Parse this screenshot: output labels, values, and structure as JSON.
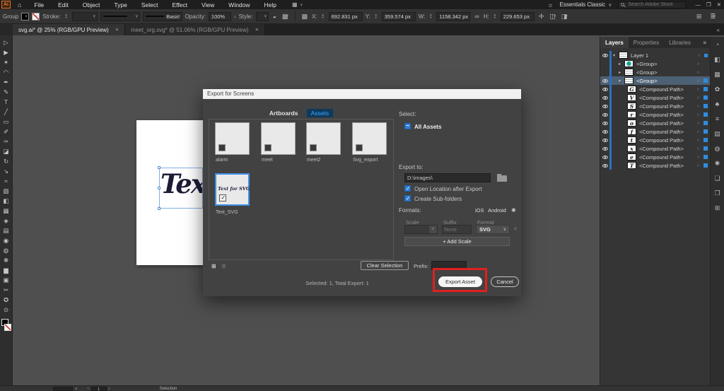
{
  "app": {
    "menus": [
      "File",
      "Edit",
      "Object",
      "Type",
      "Select",
      "Effect",
      "View",
      "Window",
      "Help"
    ],
    "workspace": "Essentials Classic",
    "search_placeholder": "Search Adobe Stock"
  },
  "control_bar": {
    "context_label": "Group",
    "stroke_label": "Stroke:",
    "brush_value": "Basic",
    "opacity_label": "Opacity:",
    "opacity_value": "100%",
    "style_label": "Style:",
    "x_label": "X:",
    "x_value": "692.831 px",
    "y_label": "Y:",
    "y_value": "359.574 px",
    "w_label": "W:",
    "w_value": "1158.342 px",
    "h_label": "H:",
    "h_value": "229.653 px"
  },
  "document_tabs": [
    {
      "label": "svg.ai* @ 25% (RGB/GPU Preview)"
    },
    {
      "label": "meet_org.svg* @ 51.06% (RGB/GPU Preview)"
    }
  ],
  "canvas": {
    "artboard_text": "Tex"
  },
  "dialog": {
    "title": "Export for Screens",
    "tab_artboards": "Artboards",
    "tab_assets": "Assets",
    "assets": [
      {
        "name": "alarm"
      },
      {
        "name": "meet"
      },
      {
        "name": "meet2"
      },
      {
        "name": "Svg_export"
      },
      {
        "name": "Text_SVG",
        "thumb_text": "Text for SVG"
      }
    ],
    "select_label": "Select:",
    "all_assets_label": "All Assets",
    "export_to_label": "Export to:",
    "export_path": "D:\\images\\",
    "open_location_label": "Open Location after Export",
    "create_subfolders_label": "Create Sub-folders",
    "formats_label": "Formats:",
    "ios_label": "iOS",
    "android_label": "Android",
    "scale_header": "Scale",
    "suffix_header": "Suffix",
    "format_header": "Format",
    "suffix_placeholder": "None",
    "format_value": "SVG",
    "add_scale_label": "+ Add Scale",
    "clear_selection_label": "Clear Selection",
    "prefix_label": "Prefix:",
    "summary": "Selected: 1, Total Export: 1",
    "export_button": "Export Asset",
    "cancel_button": "Cancel"
  },
  "layers_panel": {
    "tabs": [
      "Layers",
      "Properties",
      "Libraries"
    ],
    "rows": [
      {
        "name": "Layer 1"
      },
      {
        "name": "<Group>"
      },
      {
        "name": "<Group>"
      },
      {
        "name": "<Group>"
      },
      {
        "name": "<Compound Path>",
        "letter": "G"
      },
      {
        "name": "<Compound Path>",
        "letter": "V"
      },
      {
        "name": "<Compound Path>",
        "letter": "S"
      },
      {
        "name": "<Compound Path>",
        "letter": "r"
      },
      {
        "name": "<Compound Path>",
        "letter": "o"
      },
      {
        "name": "<Compound Path>",
        "letter": "f"
      },
      {
        "name": "<Compound Path>",
        "letter": "t"
      },
      {
        "name": "<Compound Path>",
        "letter": "x"
      },
      {
        "name": "<Compound Path>",
        "letter": "e"
      },
      {
        "name": "<Compound Path>",
        "letter": "T"
      }
    ]
  },
  "status_bar": {
    "artboard_number": "1",
    "tool_name": "Selection"
  },
  "tools": [
    {
      "name": "selection-tool",
      "glyph": "▷"
    },
    {
      "name": "direct-selection-tool",
      "glyph": "▶"
    },
    {
      "name": "magic-wand-tool",
      "glyph": "✶"
    },
    {
      "name": "lasso-tool",
      "glyph": "◠"
    },
    {
      "name": "pen-tool",
      "glyph": "✒"
    },
    {
      "name": "curvature-tool",
      "glyph": "✎"
    },
    {
      "name": "type-tool",
      "glyph": "T"
    },
    {
      "name": "line-segment-tool",
      "glyph": "╱"
    },
    {
      "name": "rectangle-tool",
      "glyph": "▭"
    },
    {
      "name": "paintbrush-tool",
      "glyph": "✐"
    },
    {
      "name": "shaper-tool",
      "glyph": "✑"
    },
    {
      "name": "eraser-tool",
      "glyph": "◪"
    },
    {
      "name": "rotate-tool",
      "glyph": "↻"
    },
    {
      "name": "scale-tool",
      "glyph": "↘"
    },
    {
      "name": "width-tool",
      "glyph": "≈"
    },
    {
      "name": "free-transform-tool",
      "glyph": "▧"
    },
    {
      "name": "shape-builder-tool",
      "glyph": "◧"
    },
    {
      "name": "perspective-grid-tool",
      "glyph": "▦"
    },
    {
      "name": "mesh-tool",
      "glyph": "◈"
    },
    {
      "name": "gradient-tool",
      "glyph": "▤"
    },
    {
      "name": "eyedropper-tool",
      "glyph": "◉"
    },
    {
      "name": "blend-tool",
      "glyph": "◍"
    },
    {
      "name": "symbol-sprayer-tool",
      "glyph": "❋"
    },
    {
      "name": "column-graph-tool",
      "glyph": "▆"
    },
    {
      "name": "artboard-tool",
      "glyph": "▣"
    },
    {
      "name": "slice-tool",
      "glyph": "✂"
    },
    {
      "name": "hand-tool",
      "glyph": "✪"
    },
    {
      "name": "zoom-tool",
      "glyph": "⊙"
    }
  ],
  "panel_icons": [
    {
      "name": "color-panel-icon",
      "glyph": "◔"
    },
    {
      "name": "color-guide-panel-icon",
      "glyph": "◧"
    },
    {
      "name": "swatches-panel-icon",
      "glyph": "▦"
    },
    {
      "name": "brushes-panel-icon",
      "glyph": "✿"
    },
    {
      "name": "symbols-panel-icon",
      "glyph": "♣"
    },
    {
      "name": "stroke-panel-icon",
      "glyph": "≡"
    },
    {
      "name": "gradient-panel-icon",
      "glyph": "▤"
    },
    {
      "name": "transparency-panel-icon",
      "glyph": "◍"
    },
    {
      "name": "appearance-panel-icon",
      "glyph": "✺"
    },
    {
      "name": "graphic-styles-panel-icon",
      "glyph": "❏"
    },
    {
      "name": "artboards-panel-icon",
      "glyph": "❐"
    },
    {
      "name": "asset-export-panel-icon",
      "glyph": "⊞"
    }
  ],
  "icons": {
    "home": "⌂",
    "arrange": "▦",
    "bulb": "☼",
    "minimize": "—",
    "restore": "❐",
    "close": "✕",
    "menu": "≡",
    "collapse": "«",
    "recolor": "◒",
    "doc_grid": "▩",
    "link": "∞",
    "transform": "✢",
    "shape_mode": "◫",
    "align": "◨",
    "grid_view": "⊞",
    "list_view": "≣",
    "remove": "✕",
    "logo": "Ai",
    "chev_left": "‹",
    "chev_right": "›"
  },
  "colors": {
    "accent_blue": "#2f8ceb",
    "annotation_red": "#e02020",
    "selected_row": "#4d6175"
  }
}
